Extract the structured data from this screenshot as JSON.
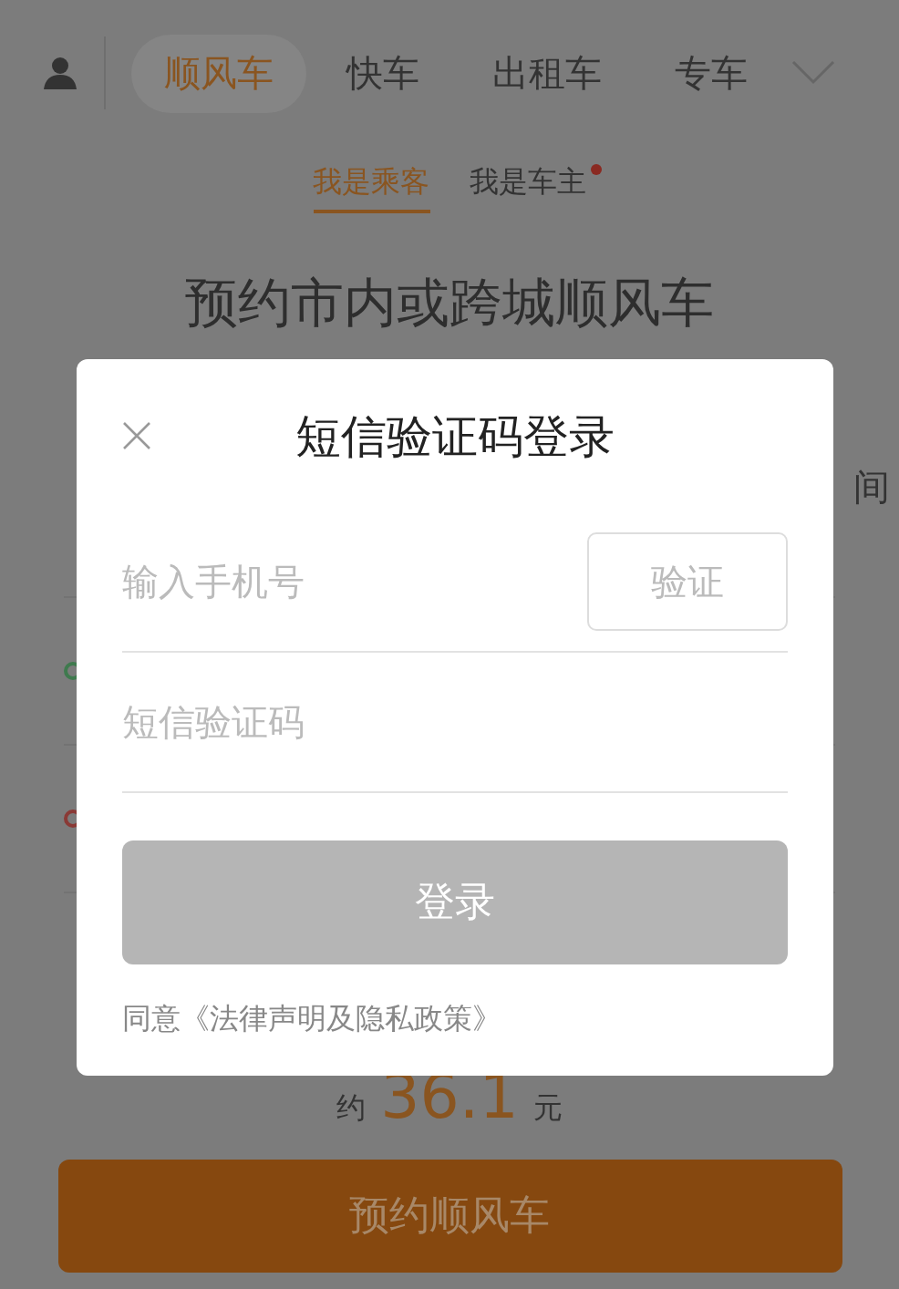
{
  "nav": {
    "tabs": [
      {
        "label": "顺风车",
        "selected": true
      },
      {
        "label": "快车",
        "selected": false
      },
      {
        "label": "出租车",
        "selected": false
      },
      {
        "label": "专车",
        "selected": false
      }
    ]
  },
  "roles": [
    {
      "label": "我是乘客",
      "selected": true,
      "badge": false
    },
    {
      "label": "我是车主",
      "selected": false,
      "badge": true
    }
  ],
  "heading": "预约市内或跨城顺风车",
  "time_field": {
    "text": "间"
  },
  "stops": [
    {
      "color": "#3f7a4e"
    },
    {
      "color": "#8a3a36"
    }
  ],
  "fare": {
    "prefix": "约",
    "amount": "36.1",
    "unit": "元"
  },
  "book_button": "预约顺风车",
  "dialog": {
    "title": "短信验证码登录",
    "phone": {
      "placeholder": "输入手机号"
    },
    "verify_button": "验证",
    "code": {
      "placeholder": "短信验证码"
    },
    "login_button": {
      "label": "登录",
      "disabled": true
    },
    "agreement": "同意《法律声明及隐私政策》"
  }
}
